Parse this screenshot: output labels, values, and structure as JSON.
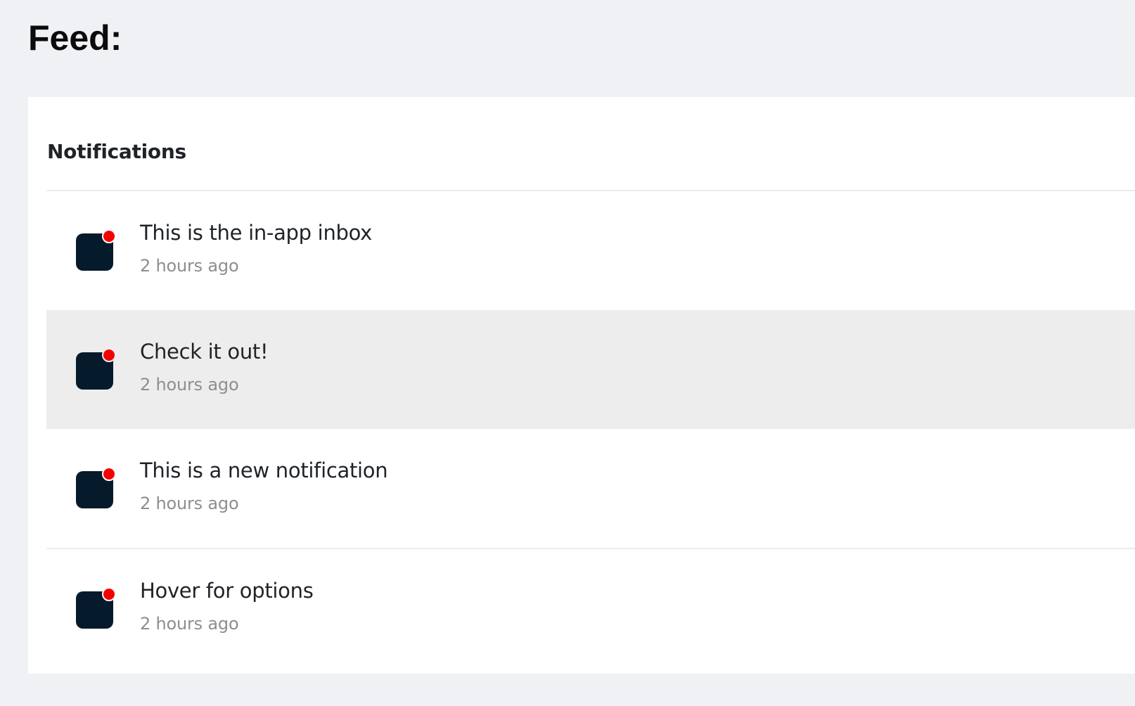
{
  "page": {
    "title": "Feed:"
  },
  "feed": {
    "header": "Notifications",
    "items": [
      {
        "title": "This is the in-app inbox",
        "time": "2 hours ago",
        "unread": true
      },
      {
        "title": "Check it out!",
        "time": "2 hours ago",
        "unread": true,
        "hovered": true
      },
      {
        "title": "This is a new notification",
        "time": "2 hours ago",
        "unread": true
      },
      {
        "title": "Hover for options",
        "time": "2 hours ago",
        "unread": true
      }
    ]
  },
  "colors": {
    "page_background": "#f0f1f4",
    "panel_background": "#ffffff",
    "avatar": "#051a2a",
    "unread_indicator": "#f50000",
    "hover_background": "#ededed",
    "timestamp_text": "#8e8e8e"
  }
}
